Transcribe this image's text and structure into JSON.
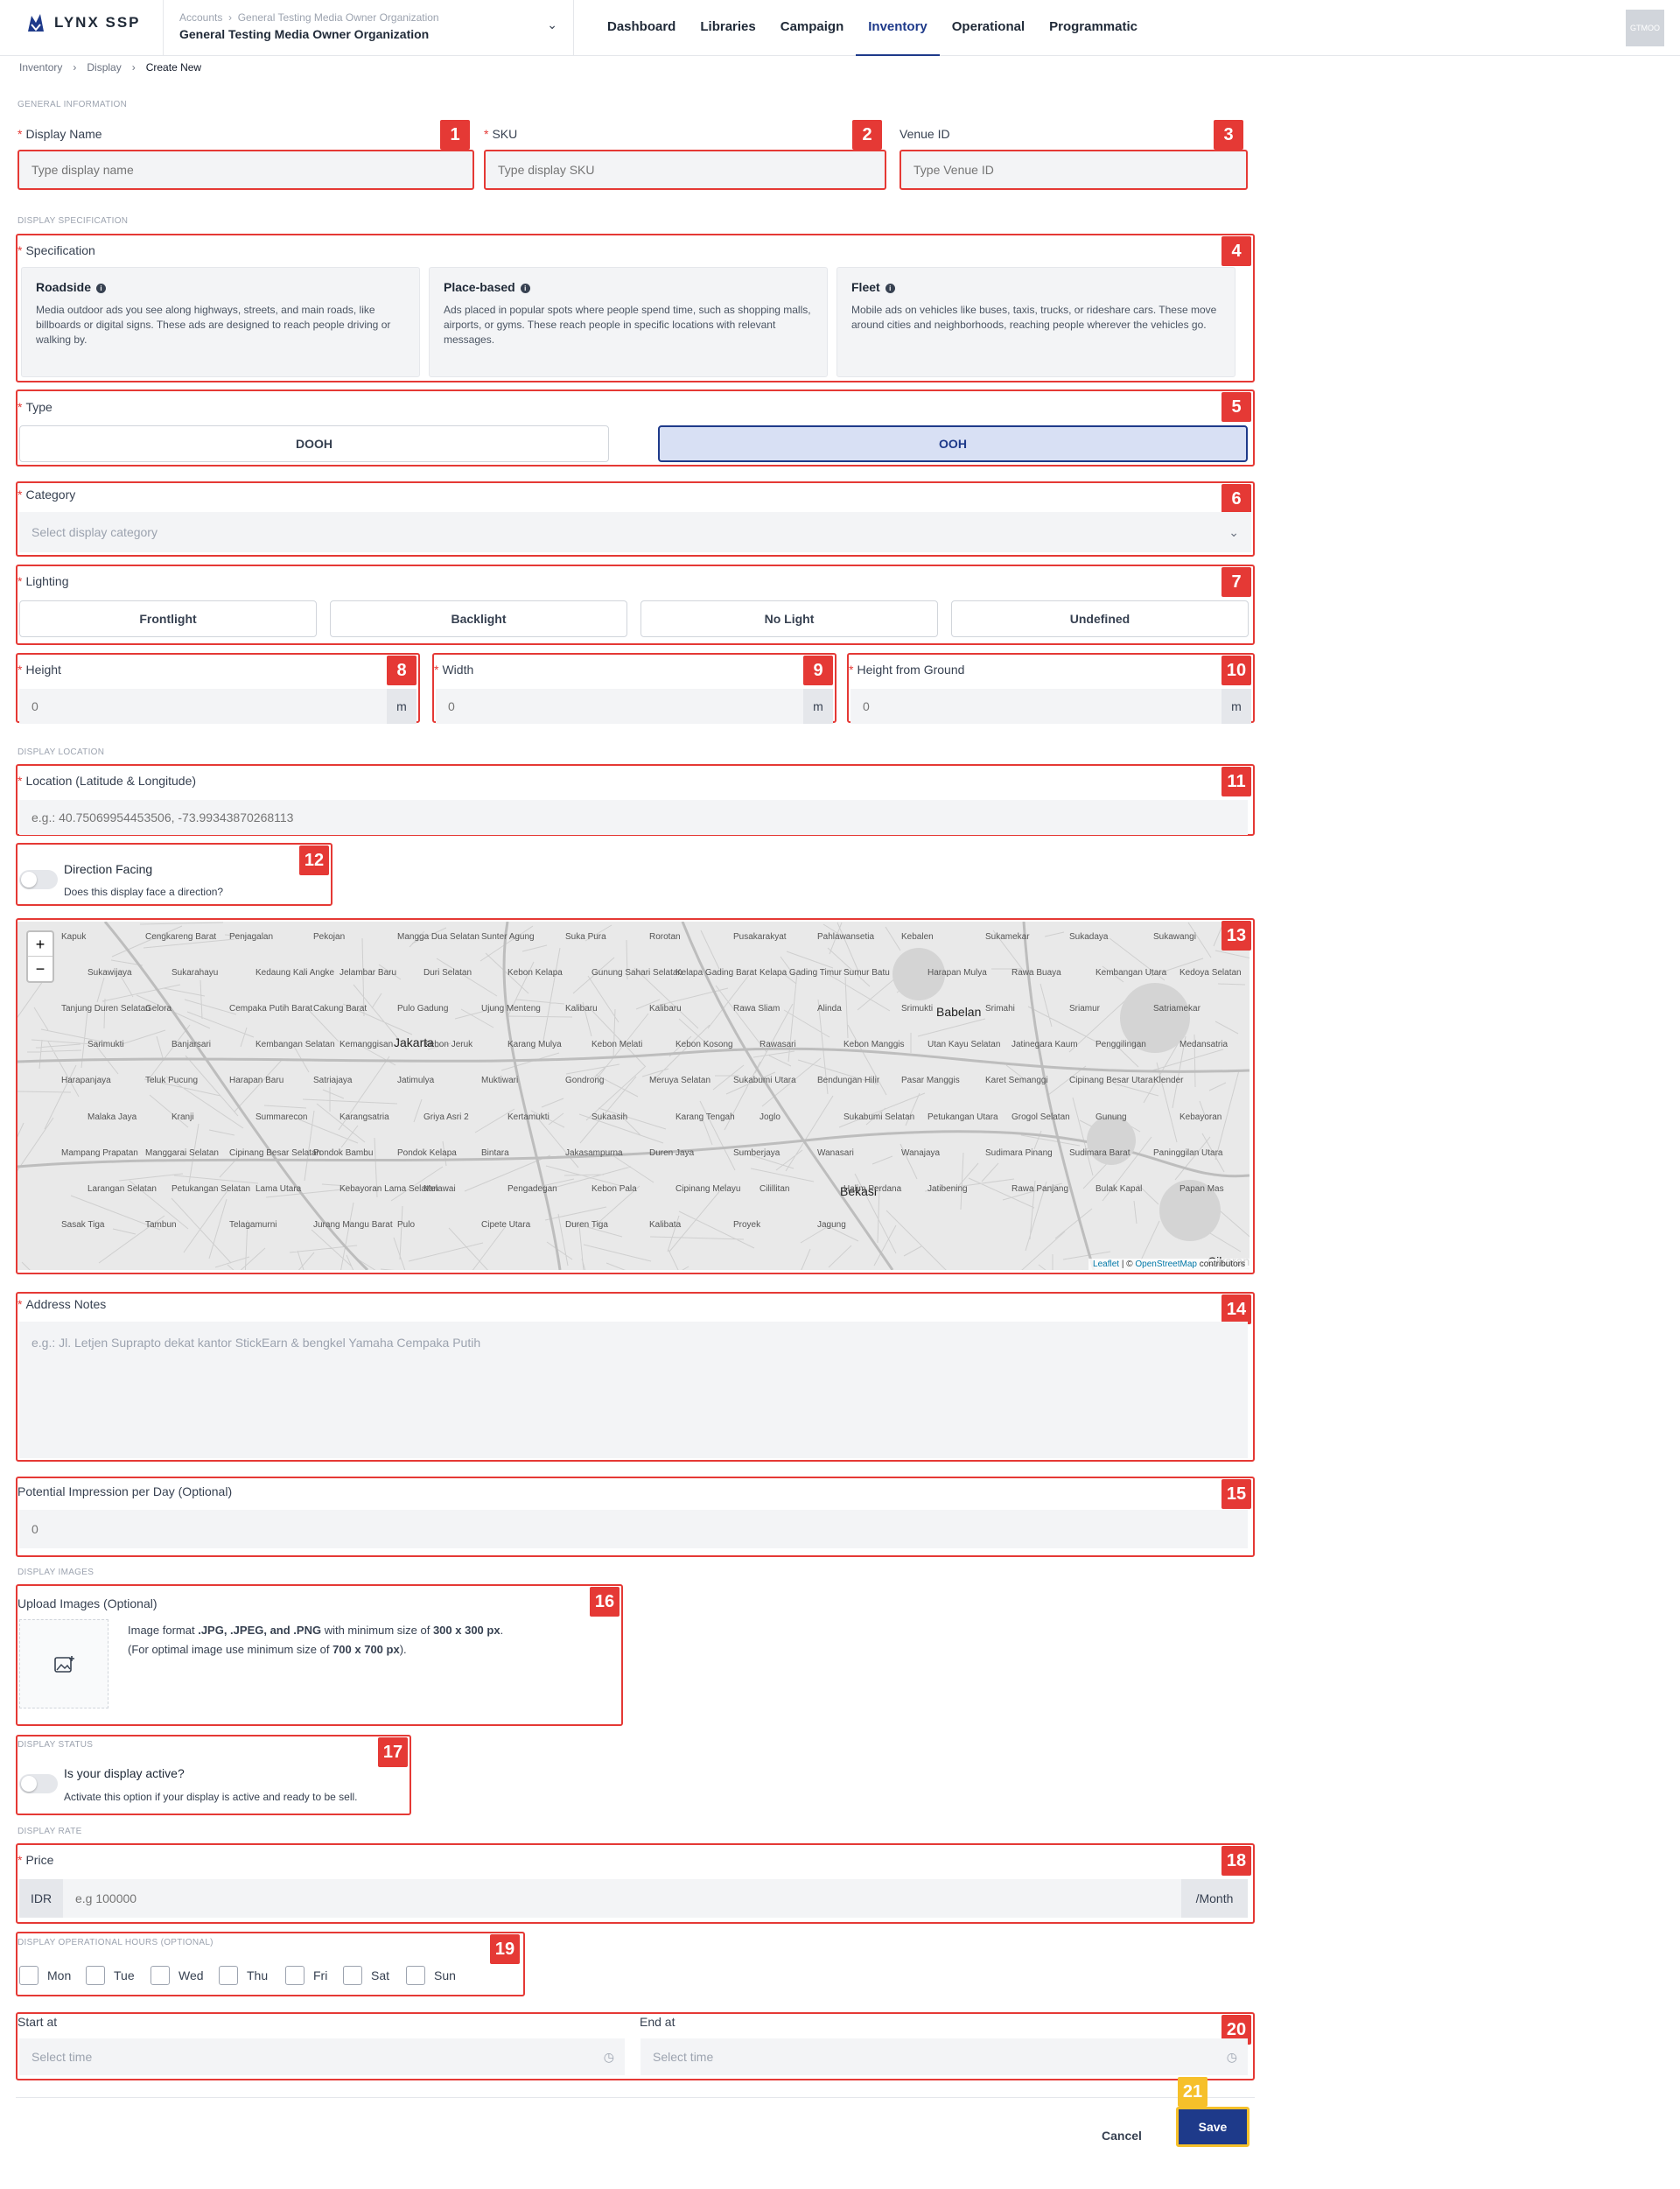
{
  "app": {
    "logo_text": "LYNX SSP",
    "org_crumb": [
      "Accounts",
      "General Testing Media Owner Organization"
    ],
    "org_name": "General Testing Media Owner Organization",
    "avatar": "GTMOO"
  },
  "nav": [
    "Dashboard",
    "Libraries",
    "Campaign",
    "Inventory",
    "Operational",
    "Programmatic"
  ],
  "nav_active": "Inventory",
  "breadcrumb": [
    "Inventory",
    "Display",
    "Create New"
  ],
  "sections": {
    "general": "GENERAL INFORMATION",
    "spec": "DISPLAY SPECIFICATION",
    "location": "DISPLAY LOCATION",
    "images": "DISPLAY IMAGES",
    "status": "DISPLAY STATUS",
    "rate": "DISPLAY RATE",
    "hours": "DISPLAY OPERATIONAL HOURS (OPTIONAL)"
  },
  "badges": [
    "1",
    "2",
    "3",
    "4",
    "5",
    "6",
    "7",
    "8",
    "9",
    "10",
    "11",
    "12",
    "13",
    "14",
    "15",
    "16",
    "17",
    "18",
    "19",
    "20",
    "21"
  ],
  "fields": {
    "display_name": {
      "label": "Display Name",
      "placeholder": "Type display name"
    },
    "sku": {
      "label": "SKU",
      "placeholder": "Type display SKU"
    },
    "venue": {
      "label": "Venue ID",
      "placeholder": "Type Venue ID"
    },
    "specification": {
      "label": "Specification"
    },
    "type": {
      "label": "Type",
      "options": [
        "DOOH",
        "OOH"
      ],
      "selected": "OOH"
    },
    "category": {
      "label": "Category",
      "placeholder": "Select display category"
    },
    "lighting": {
      "label": "Lighting",
      "options": [
        "Frontlight",
        "Backlight",
        "No Light",
        "Undefined"
      ]
    },
    "height": {
      "label": "Height",
      "placeholder": "0",
      "unit": "m"
    },
    "width": {
      "label": "Width",
      "placeholder": "0",
      "unit": "m"
    },
    "hfg": {
      "label": "Height from Ground",
      "placeholder": "0",
      "unit": "m"
    },
    "location": {
      "label": "Location (Latitude & Longitude)",
      "placeholder": "e.g.: 40.75069954453506, -73.99343870268113"
    },
    "direction": {
      "title": "Direction Facing",
      "sub": "Does this display face a direction?"
    },
    "address": {
      "label": "Address Notes",
      "placeholder": "e.g.: Jl. Letjen Suprapto dekat kantor StickEarn & bengkel Yamaha Cempaka Putih"
    },
    "impression": {
      "label": "Potential Impression per Day (Optional)",
      "placeholder": "0"
    },
    "upload": {
      "label": "Upload Images (Optional)",
      "line1_a": "Image format ",
      "line1_b": ".JPG, .JPEG, and .PNG",
      "line1_c": " with minimum size of ",
      "line1_d": "300 x 300 px",
      "line1_e": ".",
      "line2_a": "(For optimal image use minimum size of ",
      "line2_b": "700 x 700 px",
      "line2_c": ")."
    },
    "active": {
      "title": "Is your display active?",
      "sub": "Activate this option if your display is active and ready to be sell."
    },
    "price": {
      "label": "Price",
      "currency": "IDR",
      "placeholder": "e.g 100000",
      "suffix": "/Month"
    },
    "days": [
      "Mon",
      "Tue",
      "Wed",
      "Thu",
      "Fri",
      "Sat",
      "Sun"
    ],
    "start": {
      "label": "Start at",
      "placeholder": "Select time"
    },
    "end": {
      "label": "End at",
      "placeholder": "Select time"
    }
  },
  "spec_cards": [
    {
      "title": "Roadside",
      "desc": "Media outdoor ads you see along highways, streets, and main roads, like billboards or digital signs. These ads are designed to reach people driving or walking by."
    },
    {
      "title": "Place-based",
      "desc": "Ads placed in popular spots where people spend time, such as shopping malls, airports, or gyms. These reach people in specific locations with relevant messages."
    },
    {
      "title": "Fleet",
      "desc": "Mobile ads on vehicles like buses, taxis, trucks, or rideshare cars. These move around cities and neighborhoods, reaching people wherever the vehicles go."
    }
  ],
  "map": {
    "zoom_in": "+",
    "zoom_out": "−",
    "attribution_leaflet": "Leaflet",
    "attribution_sep": " | © ",
    "attribution_osm": "OpenStreetMap",
    "attribution_end": " contributors",
    "labels_big": [
      "Jakarta",
      "Babelan",
      "Bekasi",
      "Cikarang"
    ],
    "labels": [
      "Kapuk",
      "Cengkareng Barat",
      "Penjagalan",
      "Pekojan",
      "Mangga Dua Selatan",
      "Sunter Agung",
      "Suka Pura",
      "Rorotan",
      "Pusakarakyat",
      "Pahlawansetia",
      "Kebalen",
      "Sukamekar",
      "Sukadaya",
      "Sukawangi",
      "Sukawijaya",
      "Sukarahayu",
      "Kedaung Kali Angke",
      "Jelambar Baru",
      "Duri Selatan",
      "Kebon Kelapa",
      "Gunung Sahari Selatan",
      "Kelapa Gading Barat",
      "Kelapa Gading Timur",
      "Sumur Batu",
      "Harapan Mulya",
      "Rawa Buaya",
      "Kembangan Utara",
      "Kedoya Selatan",
      "Tanjung Duren Selatan",
      "Gelora",
      "Cempaka Putih Barat",
      "Cakung Barat",
      "Pulo Gadung",
      "Ujung Menteng",
      "Kalibaru",
      "Kalibaru",
      "Rawa Sliam",
      "Alinda",
      "Srimukti",
      "Srimahi",
      "Sriamur",
      "Satriamekar",
      "Sarimukti",
      "Banjarsari",
      "Kembangan Selatan",
      "Kemanggisan",
      "Kebon Jeruk",
      "Karang Mulya",
      "Kebon Melati",
      "Kebon Kosong",
      "Rawasari",
      "Kebon Manggis",
      "Utan Kayu Selatan",
      "Jatinegara Kaum",
      "Penggilingan",
      "Medansatria",
      "Harapanjaya",
      "Teluk Pucung",
      "Harapan Baru",
      "Satriajaya",
      "Jatimulya",
      "Muktiwari",
      "Gondrong",
      "Meruya Selatan",
      "Sukabumi Utara",
      "Bendungan Hilir",
      "Pasar Manggis",
      "Karet Semanggi",
      "Cipinang Besar Utara",
      "Klender",
      "Malaka Jaya",
      "Kranji",
      "Summarecon",
      "Karangsatria",
      "Griya Asri 2",
      "Kertamukti",
      "Sukaasih",
      "Karang Tengah",
      "Joglo",
      "Sukabumi Selatan",
      "Petukangan Utara",
      "Grogol Selatan",
      "Gunung",
      "Kebayoran",
      "Mampang Prapatan",
      "Manggarai Selatan",
      "Cipinang Besar Selatan",
      "Pondok Bambu",
      "Pondok Kelapa",
      "Bintara",
      "Jakasampurna",
      "Duren Jaya",
      "Sumberjaya",
      "Wanasari",
      "Wanajaya",
      "Sudimara Pinang",
      "Sudimara Barat",
      "Paninggilan Utara",
      "Larangan Selatan",
      "Petukangan Selatan",
      "Lama Utara",
      "Kebayoran Lama Selatan",
      "Melawai",
      "Pengadegan",
      "Kebon Pala",
      "Cipinang Melayu",
      "Cilillitan",
      "Halim Perdana",
      "Jatibening",
      "Rawa Panjang",
      "Bulak Kapal",
      "Papan Mas",
      "Sasak Tiga",
      "Tambun",
      "Telagamurni",
      "Jurang Mangu Barat",
      "Pulo",
      "Cipete Utara",
      "Duren Tiga",
      "Kalibata",
      "Proyek",
      "Jagung"
    ]
  }
}
